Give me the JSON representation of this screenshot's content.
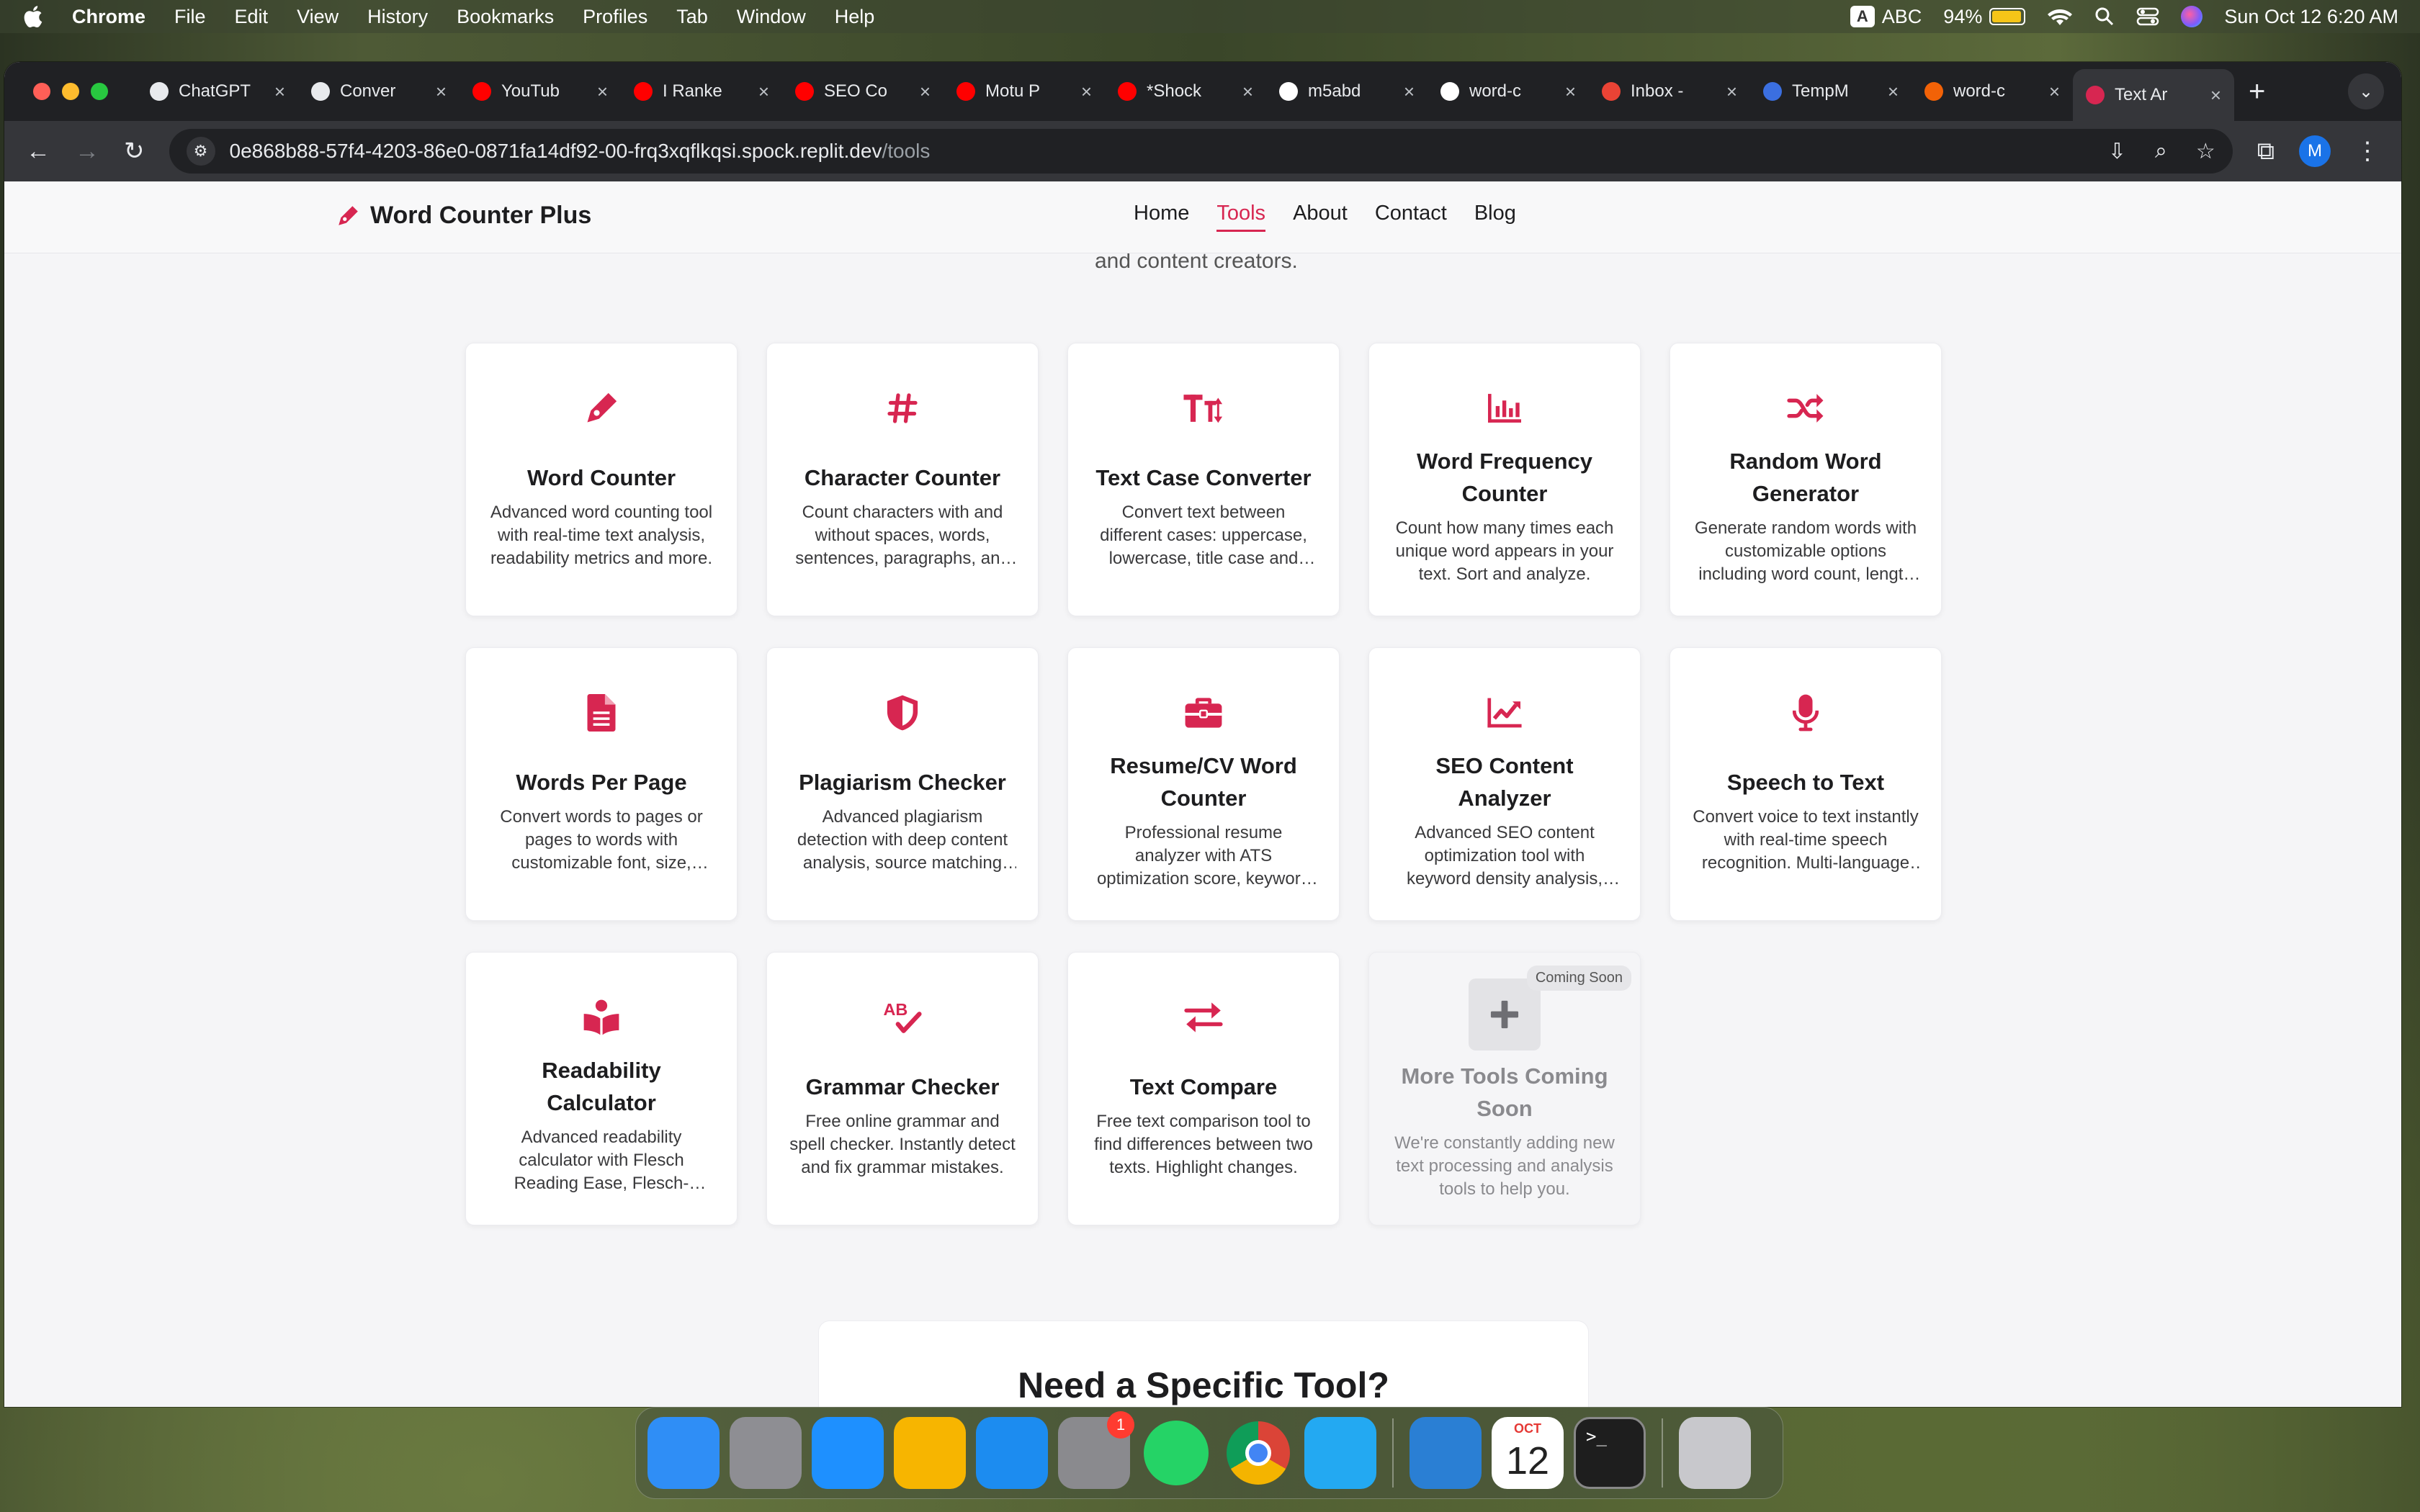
{
  "menubar": {
    "app": "Chrome",
    "items": [
      "File",
      "Edit",
      "View",
      "History",
      "Bookmarks",
      "Profiles",
      "Tab",
      "Window",
      "Help"
    ],
    "input_source_badge": "A",
    "input_source": "ABC",
    "battery": "94%",
    "datetime": "Sun Oct 12  6:20 AM"
  },
  "tabs": [
    {
      "label": "ChatGPT",
      "favicon": "chatgpt-icon",
      "color": "#e8eaed"
    },
    {
      "label": "Conver",
      "favicon": "chatgpt-icon",
      "color": "#e8eaed"
    },
    {
      "label": "YouTub",
      "favicon": "youtube-icon",
      "color": "#ff0000"
    },
    {
      "label": "I Ranke",
      "favicon": "youtube-icon",
      "color": "#ff0000"
    },
    {
      "label": "SEO Co",
      "favicon": "youtube-icon",
      "color": "#ff0000"
    },
    {
      "label": "Motu P",
      "favicon": "youtube-icon",
      "color": "#ff0000"
    },
    {
      "label": "*Shock",
      "favicon": "youtube-icon",
      "color": "#ff0000"
    },
    {
      "label": "m5abd",
      "favicon": "github-icon",
      "color": "#ffffff"
    },
    {
      "label": "word-c",
      "favicon": "vercel-icon",
      "color": "#ffffff"
    },
    {
      "label": "Inbox -",
      "favicon": "gmail-icon",
      "color": "#ea4335"
    },
    {
      "label": "TempM",
      "favicon": "mail-icon",
      "color": "#3b6fe0"
    },
    {
      "label": "word-c",
      "favicon": "replit-icon",
      "color": "#f26207"
    },
    {
      "label": "Text Ar",
      "favicon": "pen-icon",
      "color": "#d72651",
      "active": true
    }
  ],
  "toolbar": {
    "url_host": "0e868b88-57f4-4203-86e0-0871fa14df92-00-frq3xqflkqsi.spock.replit.dev",
    "url_path": "/tools",
    "profile_initial": "M"
  },
  "site": {
    "brand": "Word Counter Plus",
    "nav": [
      {
        "label": "Home",
        "active": false
      },
      {
        "label": "Tools",
        "active": true
      },
      {
        "label": "About",
        "active": false
      },
      {
        "label": "Contact",
        "active": false
      },
      {
        "label": "Blog",
        "active": false
      }
    ],
    "subtitle_peek": "and content creators.",
    "accent": "#d72651"
  },
  "tools": [
    {
      "icon": "pen-nib-icon",
      "title": "Word Counter",
      "desc": "Advanced word counting tool with real-time text analysis, readability metrics and more."
    },
    {
      "icon": "hashtag-icon",
      "title": "Character Counter",
      "desc": "Count characters with and without spaces, words, sentences, paragraphs, and more."
    },
    {
      "icon": "text-height-icon",
      "title": "Text Case Converter",
      "desc": "Convert text between different cases: uppercase, lowercase, title case and more."
    },
    {
      "icon": "bar-chart-icon",
      "title": "Word Frequency Counter",
      "desc": "Count how many times each unique word appears in your text. Sort and analyze."
    },
    {
      "icon": "shuffle-icon",
      "title": "Random Word Generator",
      "desc": "Generate random words with customizable options including word count, length and more."
    },
    {
      "icon": "file-lines-icon",
      "title": "Words Per Page",
      "desc": "Convert words to pages or pages to words with customizable font, size, spacing and more."
    },
    {
      "icon": "shield-icon",
      "title": "Plagiarism Checker",
      "desc": "Advanced plagiarism detection with deep content analysis, source matching and more."
    },
    {
      "icon": "briefcase-icon",
      "title": "Resume/CV Word Counter",
      "desc": "Professional resume analyzer with ATS optimization score, keyword tips and more."
    },
    {
      "icon": "chart-line-icon",
      "title": "SEO Content Analyzer",
      "desc": "Advanced SEO content optimization tool with keyword density analysis, readability and more."
    },
    {
      "icon": "microphone-icon",
      "title": "Speech to Text",
      "desc": "Convert voice to text instantly with real-time speech recognition. Multi-language support."
    },
    {
      "icon": "book-reader-icon",
      "title": "Readability Calculator",
      "desc": "Advanced readability calculator with Flesch Reading Ease, Flesch-Kincaid grade and more."
    },
    {
      "icon": "spell-check-icon",
      "title": "Grammar Checker",
      "desc": "Free online grammar and spell checker. Instantly detect and fix grammar mistakes."
    },
    {
      "icon": "exchange-icon",
      "title": "Text Compare",
      "desc": "Free text comparison tool to find differences between two texts. Highlight changes."
    },
    {
      "icon": "plus-icon",
      "title": "More Tools Coming Soon",
      "desc": "We're constantly adding new text processing and analysis tools to help you.",
      "badge": "Coming Soon",
      "disabled": true
    }
  ],
  "cta": {
    "title": "Need a Specific Tool?"
  },
  "dock": {
    "apps": [
      {
        "name": "finder-icon",
        "color": "#2f8ef6"
      },
      {
        "name": "launchpad-icon",
        "color": "#8e8e93"
      },
      {
        "name": "safari-icon",
        "color": "#1e90ff"
      },
      {
        "name": "photos-icon",
        "color": "#f7b500"
      },
      {
        "name": "app-store-icon",
        "color": "#1c8cf0"
      },
      {
        "name": "system-settings-icon",
        "color": "#8a8a8e",
        "badge": "1"
      },
      {
        "name": "whatsapp-icon",
        "color": "#25d366"
      },
      {
        "name": "chrome-icon",
        "color": "#ffffff"
      },
      {
        "name": "vscode-icon",
        "color": "#23a9f2"
      },
      {
        "name": "migration-icon",
        "color": "#2a7fd4"
      },
      {
        "name": "calendar-icon",
        "color": "#ffffff",
        "month": "OCT",
        "day": "12"
      },
      {
        "name": "terminal-icon",
        "color": "#1e1e1e"
      },
      {
        "name": "trash-icon",
        "color": "#c8c8cc"
      }
    ]
  }
}
